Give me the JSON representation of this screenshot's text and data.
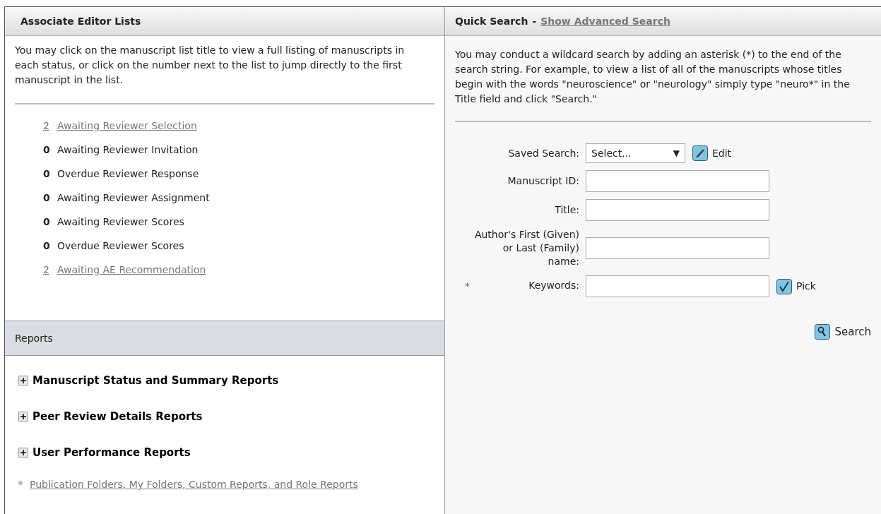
{
  "left_panel": {
    "title": "Associate Editor Lists",
    "description": "You may click on the manuscript list title to view a full listing of manuscripts in each status, or click on the number next to the list to jump directly to the first manuscript in the list.",
    "lists": [
      {
        "count": "2",
        "label": "Awaiting Reviewer Selection",
        "linked": true
      },
      {
        "count": "0",
        "label": "Awaiting Reviewer Invitation",
        "linked": false
      },
      {
        "count": "0",
        "label": "Overdue Reviewer Response",
        "linked": false
      },
      {
        "count": "0",
        "label": "Awaiting Reviewer Assignment",
        "linked": false
      },
      {
        "count": "0",
        "label": "Awaiting Reviewer Scores",
        "linked": false
      },
      {
        "count": "0",
        "label": "Overdue Reviewer Scores",
        "linked": false
      },
      {
        "count": "2",
        "label": "Awaiting AE Recommendation",
        "linked": true
      }
    ]
  },
  "reports": {
    "title": "Reports",
    "sections": [
      {
        "label": "Manuscript Status and Summary Reports",
        "expanded": false
      },
      {
        "label": "Peer Review Details Reports",
        "expanded": false
      },
      {
        "label": "User Performance Reports",
        "expanded": false
      }
    ],
    "link": "Publication Folders, My Folders, Custom Reports, and Role Reports"
  },
  "right_panel": {
    "title": "Quick Search",
    "separator": "-",
    "advanced_link": "Show Advanced Search",
    "description": "You may conduct a wildcard search by adding an asterisk (*) to the end of the search string. For example, to view a list of all of the manuscripts whose titles begin with the words \"neuroscience\" or \"neurology\" simply type \"neuro*\" in the Title field and click \"Search.\"",
    "fields": [
      {
        "kind": "select",
        "label": "Saved Search:",
        "value": "Select...",
        "arrow": "▼",
        "action": "Edit"
      },
      {
        "kind": "text",
        "label": "Manuscript ID:"
      },
      {
        "kind": "text",
        "label": "Title:"
      },
      {
        "kind": "text",
        "label": "Author's First (Given) or Last (Family) name:"
      },
      {
        "kind": "text",
        "label": "Keywords:",
        "required_mark": "*",
        "action": "Pick"
      }
    ],
    "search_button": "Search"
  }
}
